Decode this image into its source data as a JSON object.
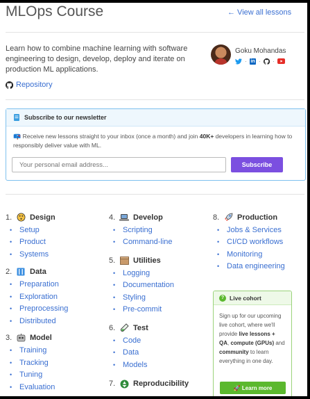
{
  "header": {
    "title": "MLOps Course",
    "view_all": "← View all lessons"
  },
  "intro": {
    "text": "Learn how to combine machine learning with software engineering to design, develop, deploy and iterate on production ML applications.",
    "repository": "Repository"
  },
  "author": {
    "name": "Goku Mohandas",
    "socials": [
      "twitter-icon",
      "linkedin-icon",
      "github-icon",
      "youtube-icon"
    ]
  },
  "newsletter": {
    "title": "Subscribe to our newsletter",
    "body_prefix": "Receive new lessons straight to your inbox (once a month) and join ",
    "body_count": "40K+",
    "body_suffix": " developers in learning how to responsibly deliver value with ML.",
    "email_placeholder": "Your personal email address...",
    "subscribe_label": "Subscribe",
    "colors": {
      "accent": "#7b4fe0",
      "border": "#7ec1ee"
    }
  },
  "sections": [
    {
      "num": "1.",
      "title": "Design",
      "icon": "art-palette-icon",
      "items": [
        "Setup",
        "Product",
        "Systems"
      ]
    },
    {
      "num": "2.",
      "title": "Data",
      "icon": "abacus-icon",
      "items": [
        "Preparation",
        "Exploration",
        "Preprocessing",
        "Distributed"
      ]
    },
    {
      "num": "3.",
      "title": "Model",
      "icon": "robot-icon",
      "items": [
        "Training",
        "Tracking",
        "Tuning",
        "Evaluation"
      ]
    },
    {
      "num": "4.",
      "title": "Develop",
      "icon": "laptop-icon",
      "items": [
        "Scripting",
        "Command-line"
      ]
    },
    {
      "num": "5.",
      "title": "Utilities",
      "icon": "box-icon",
      "items": [
        "Logging",
        "Documentation",
        "Styling",
        "Pre-commit"
      ]
    },
    {
      "num": "6.",
      "title": "Test",
      "icon": "test-tube-icon",
      "items": [
        "Code",
        "Data",
        "Models"
      ]
    },
    {
      "num": "7.",
      "title": "Reproducibility",
      "icon": "recycle-icon",
      "items": []
    },
    {
      "num": "8.",
      "title": "Production",
      "icon": "rocket-icon",
      "items": [
        "Jobs & Services",
        "CI/CD workflows",
        "Monitoring",
        "Data engineering"
      ]
    }
  ],
  "cohort": {
    "title": "Live cohort",
    "body": [
      {
        "t": "Sign up for our upcoming live cohort, where we'll provide ",
        "b": false
      },
      {
        "t": "live lessons + QA",
        "b": true
      },
      {
        "t": ", ",
        "b": false
      },
      {
        "t": "compute (GPUs)",
        "b": true
      },
      {
        "t": " and ",
        "b": false
      },
      {
        "t": "community",
        "b": true
      },
      {
        "t": " to learn everything in one day.",
        "b": false
      }
    ],
    "button": "Learn more",
    "color": "#5bb82e"
  }
}
